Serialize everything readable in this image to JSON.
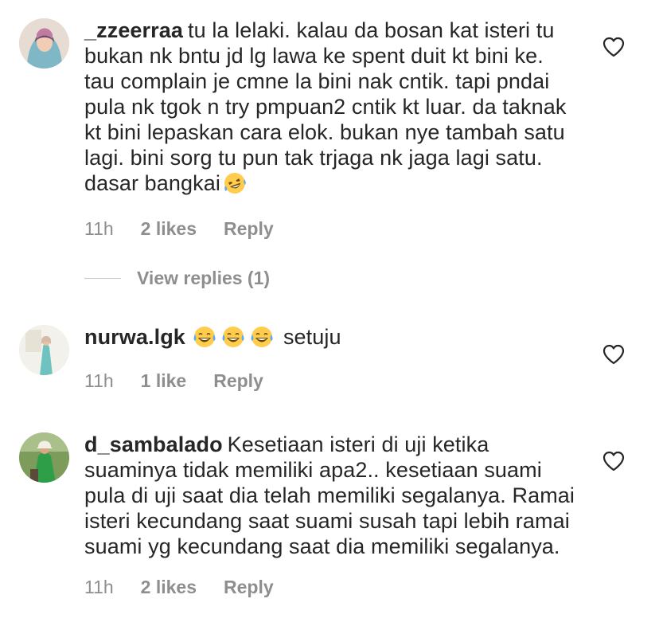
{
  "comments": [
    {
      "username": "_zzeerraa",
      "text": "tu la lelaki. kalau da bosan kat isteri tu bukan nk bntu jd lg lawa ke spent duit kt bini ke. tau complain je cmne la bini nak cntik. tapi pndai pula nk tgok n try pmpuan2 cntik kt luar. da taknak kt bini lepaskan cara elok. bukan nye tambah satu lagi. bini sorg tu pun tak trjaga nk jaga lagi satu. dasar bangkai",
      "trailing_emoji": "rofl-emoji",
      "time": "11h",
      "likes": "2 likes",
      "reply": "Reply",
      "view_replies": "View replies (1)"
    },
    {
      "username": "nurwa.lgk",
      "emojis": [
        "joy-emoji",
        "joy-emoji",
        "joy-emoji"
      ],
      "text": "setuju",
      "time": "11h",
      "likes": "1 like",
      "reply": "Reply"
    },
    {
      "username": "d_sambalado",
      "text": "Kesetiaan isteri di uji ketika suaminya tidak memiliki apa2.. kesetiaan suami pula di uji saat dia telah memiliki segalanya. Ramai isteri kecundang saat suami susah tapi lebih ramai suami yg kecundang saat dia memiliki segalanya.",
      "time": "11h",
      "likes": "2 likes",
      "reply": "Reply"
    }
  ],
  "colors": {
    "text": "#262626",
    "meta": "#8e8e8e",
    "divider": "#c7c7c7",
    "emoji_face": "#ffcc4d"
  },
  "icons": {
    "like": "heart-outline-icon"
  }
}
